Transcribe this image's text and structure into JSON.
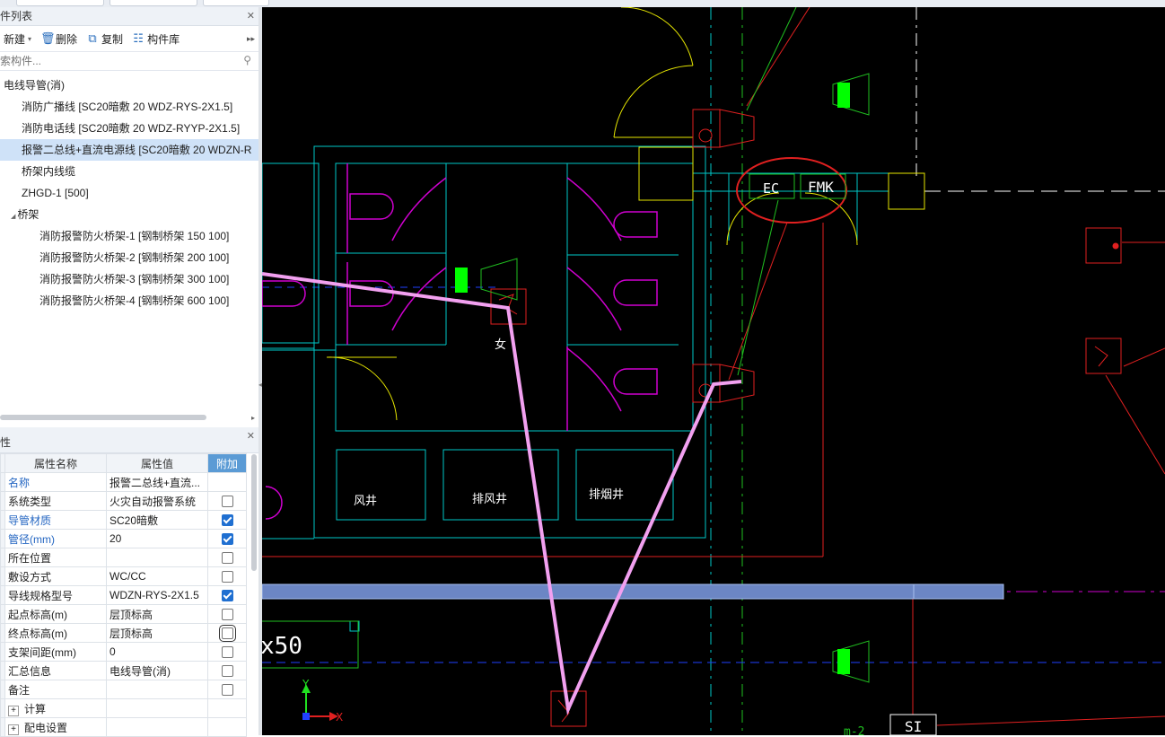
{
  "component_list": {
    "title": "件列表",
    "toolbar": {
      "new": "新建",
      "delete": "删除",
      "copy": "复制",
      "library": "构件库"
    },
    "search_placeholder": "索构件...",
    "tree": [
      {
        "label": "电线导管(消)",
        "level": 0
      },
      {
        "label": "消防广播线 [SC20暗敷 20 WDZ-RYS-2X1.5]",
        "level": 1
      },
      {
        "label": "消防电话线 [SC20暗敷 20 WDZ-RYYP-2X1.5]",
        "level": 1
      },
      {
        "label": "报警二总线+直流电源线 [SC20暗敷 20 WDZN-R",
        "level": 1,
        "selected": true
      },
      {
        "label": "桥架内线缆",
        "level": 1
      },
      {
        "label": "ZHGD-1 [500]",
        "level": 1
      },
      {
        "label": "桥架",
        "level": 1,
        "expanded": true
      },
      {
        "label": "消防报警防火桥架-1 [钢制桥架 150 100]",
        "level": 2
      },
      {
        "label": "消防报警防火桥架-2 [钢制桥架 200 100]",
        "level": 2
      },
      {
        "label": "消防报警防火桥架-3 [钢制桥架 300 100]",
        "level": 2
      },
      {
        "label": "消防报警防火桥架-4 [钢制桥架 600 100]",
        "level": 2
      }
    ]
  },
  "properties": {
    "title": "性",
    "headers": {
      "num": "",
      "name": "属性名称",
      "value": "属性值",
      "extra": "附加"
    },
    "rows": [
      {
        "num": "",
        "name": "名称",
        "value": "报警二总线+直流...",
        "blue": true,
        "checkbox": null
      },
      {
        "num": "",
        "name": "系统类型",
        "value": "火灾自动报警系统",
        "blue": false,
        "checkbox": false
      },
      {
        "num": "",
        "name": "导管材质",
        "value": "SC20暗敷",
        "blue": true,
        "checkbox": true
      },
      {
        "num": "",
        "name": "管径(mm)",
        "value": "20",
        "blue": true,
        "checkbox": true
      },
      {
        "num": "",
        "name": "所在位置",
        "value": "",
        "blue": false,
        "checkbox": false
      },
      {
        "num": "",
        "name": "敷设方式",
        "value": "WC/CC",
        "blue": false,
        "checkbox": false
      },
      {
        "num": "",
        "name": "导线规格型号",
        "value": "WDZN-RYS-2X1.5",
        "blue": false,
        "checkbox": true
      },
      {
        "num": "",
        "name": "起点标高(m)",
        "value": "层顶标高",
        "blue": false,
        "checkbox": false
      },
      {
        "num": "",
        "name": "终点标高(m)",
        "value": "层顶标高",
        "blue": false,
        "checkbox": false,
        "focus": true
      },
      {
        "num": "",
        "name": "支架间距(mm)",
        "value": "0",
        "blue": false,
        "checkbox": false
      },
      {
        "num": "",
        "name": "汇总信息",
        "value": "电线导管(消)",
        "blue": false,
        "checkbox": false
      },
      {
        "num": "",
        "name": "备注",
        "value": "",
        "blue": false,
        "checkbox": false
      },
      {
        "num": "+",
        "name": "计算",
        "value": "",
        "blue": false,
        "checkbox": null
      },
      {
        "num": "+",
        "name": "配电设置",
        "value": "",
        "blue": false,
        "checkbox": null
      }
    ]
  },
  "canvas": {
    "labels": {
      "ec": "EC",
      "fmk": "FMK",
      "female": "女",
      "shaft_wind": "风井",
      "shaft_exhaust": "排风井",
      "shaft_smoke": "排烟井",
      "dim": "x50",
      "si": "SI",
      "partial_tag": "m-2",
      "axis_y": "Y",
      "axis_x": "X"
    },
    "colors": {
      "wall": "#00c8c8",
      "fixture": "#d000d0",
      "door": "#e6e600",
      "device": "#e02020",
      "wire": "#f2a0f0",
      "green": "#00ff00",
      "blue_dash": "#2040ff"
    }
  }
}
